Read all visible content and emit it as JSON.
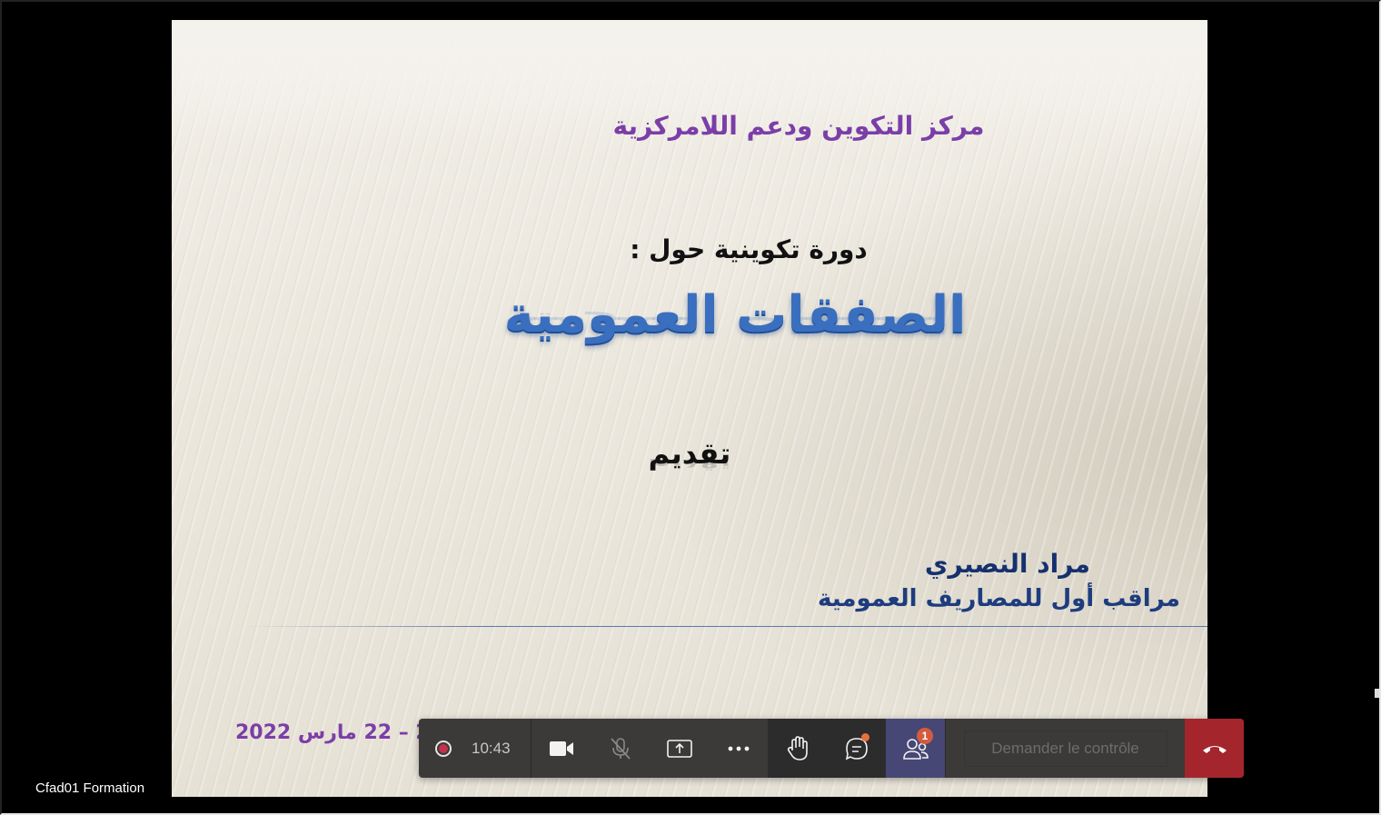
{
  "slide": {
    "organization": "مركز التكوين ودعم اللامركزية",
    "course_lead": "دورة تكوينية حول :",
    "course_title": "الصفقات العمومية",
    "presented": "تقديم",
    "author_name": "مراد النصيري",
    "author_role": "مراقب أول للمصاريف العمومية",
    "date": "21 – 22 مارس 2022"
  },
  "participant": {
    "name": "Cfad01 Formation"
  },
  "toolbar": {
    "elapsed_time": "10:43",
    "participants_count": "1",
    "request_control_label": "Demander le contrôle",
    "icons": {
      "record": "recording-indicator-icon",
      "camera": "video-camera-icon",
      "mic": "microphone-muted-icon",
      "share": "share-screen-icon",
      "more": "more-actions-icon",
      "hand": "raise-hand-icon",
      "chat": "chat-icon",
      "people": "participants-icon",
      "hangup": "hang-up-icon"
    }
  },
  "colors": {
    "toolbar_bg": "#3b3a39",
    "active_button": "#464775",
    "hangup": "#a4262c",
    "record": "#c4314b",
    "badge": "#d35b3e",
    "slide_purple": "#7b3ea8",
    "slide_blue": "#3a6fbf",
    "slide_navy": "#16306e"
  }
}
